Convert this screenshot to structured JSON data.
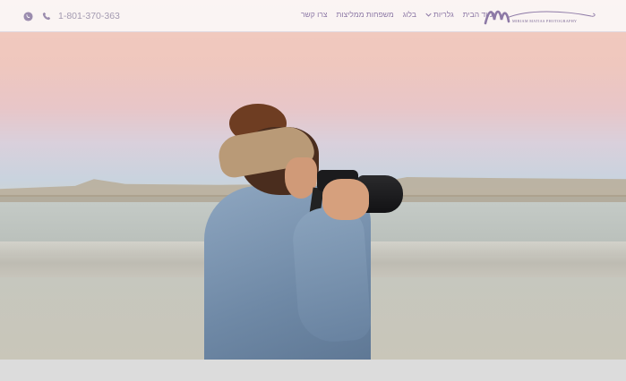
{
  "header": {
    "phone": "1-801-370-363",
    "whatsapp_icon": "whatsapp-icon",
    "phone_icon": "phone-icon",
    "nav": [
      {
        "label": "עמוד הבית"
      },
      {
        "label": "גלריות",
        "has_dropdown": true
      },
      {
        "label": "בלוג"
      },
      {
        "label": "משפחות ממליצות"
      },
      {
        "label": "צרו קשר"
      }
    ],
    "logo_caption": "MIRIAM MATIAS PHOTOGRAPHY"
  },
  "colors": {
    "brand": "#8d79a6",
    "header_bg": "#fcfafc"
  }
}
